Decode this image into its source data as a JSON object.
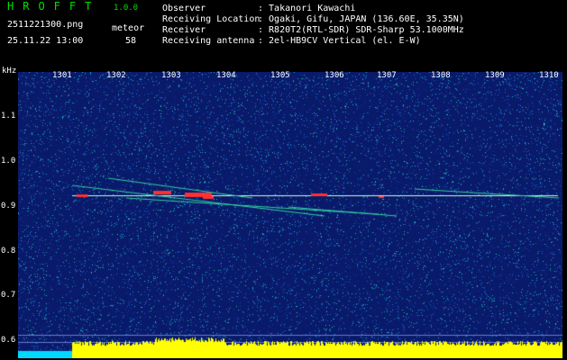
{
  "app": {
    "name": "HROFFT",
    "version": "1.0.0"
  },
  "image_file": "2511221300.png",
  "datetime": "25.11.22 13:00",
  "mode_label": "meteor",
  "meteor_count": "58",
  "info": [
    {
      "label": "Observer",
      "value": ": Takanori Kawachi"
    },
    {
      "label": "Receiving Location",
      "value": ": Ogaki, Gifu, JAPAN (136.60E, 35.35N)"
    },
    {
      "label": "Receiver",
      "value": ": R820T2(RTL-SDR) SDR-Sharp 53.1000MHz"
    },
    {
      "label": "Receiving antenna",
      "value": ": 2el-HB9CV Vertical (el. E-W)"
    }
  ],
  "freq_unit": "kHz",
  "y_ticks": [
    "1.1",
    "1.0",
    "0.9",
    "0.8",
    "0.7",
    "0.6"
  ],
  "x_ticks": [
    "1301",
    "1302",
    "1303",
    "1304",
    "1305",
    "1306",
    "1307",
    "1308",
    "1309",
    "1310"
  ],
  "colors": {
    "background": "#000000",
    "title": "#00e000",
    "spectrum_bg": "#0a1a6a",
    "carrier": "#c8ffc8",
    "echo": "#ff3030",
    "noise_bar": "#ffff00"
  }
}
